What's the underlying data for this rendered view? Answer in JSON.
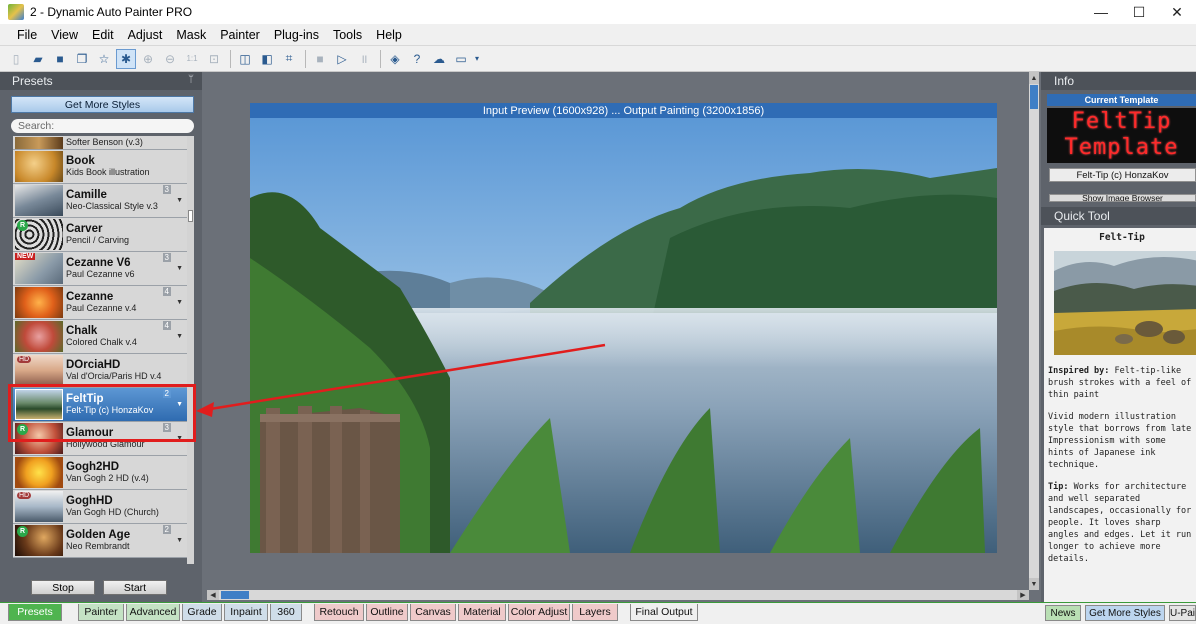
{
  "window": {
    "title": "2 - Dynamic Auto Painter PRO",
    "minimize": "—",
    "maximize": "☐",
    "close": "✕"
  },
  "menu": [
    "File",
    "View",
    "Edit",
    "Adjust",
    "Mask",
    "Painter",
    "Plug-ins",
    "Tools",
    "Help"
  ],
  "left_panel": {
    "header": "Presets",
    "pin_icon": "pin-icon",
    "get_more_label": "Get More Styles",
    "search_placeholder": "Search:",
    "presets": [
      {
        "name": "",
        "sub": "Softer Benson (v.3)"
      },
      {
        "name": "Book",
        "sub": "Kids Book illustration"
      },
      {
        "name": "Camille",
        "sub": "Neo-Classical Style v.3",
        "num": "3"
      },
      {
        "name": "Carver",
        "sub": "Pencil / Carving",
        "badge": "R"
      },
      {
        "name": "Cezanne V6",
        "sub": "Paul Cezanne v6",
        "num": "3",
        "badge": "NEW"
      },
      {
        "name": "Cezanne",
        "sub": "Paul Cezanne v.4",
        "num": "4"
      },
      {
        "name": "Chalk",
        "sub": "Colored Chalk v.4",
        "num": "4"
      },
      {
        "name": "DOrciaHD",
        "sub": "Val d'Orcia/Paris HD v.4",
        "badge": "HD"
      },
      {
        "name": "FeltTip",
        "sub": "Felt-Tip (c) HonzaKov",
        "num": "2",
        "selected": true
      },
      {
        "name": "Glamour",
        "sub": "Hollywood Glamour",
        "num": "3",
        "badge": "R"
      },
      {
        "name": "Gogh2HD",
        "sub": "Van Gogh 2 HD (v.4)"
      },
      {
        "name": "GoghHD",
        "sub": "Van Gogh HD (Church)",
        "badge": "HD"
      },
      {
        "name": "Golden Age",
        "sub": "Neo Rembrandt",
        "num": "2",
        "badge": "R"
      }
    ],
    "stop_label": "Stop",
    "start_label": "Start"
  },
  "canvas": {
    "caption": "Input Preview (1600x928) ... Output Painting (3200x1856)"
  },
  "info_panel": {
    "header": "Info",
    "current_template_label": "Current Template",
    "led_line1": "FeltTip",
    "led_line2": "Template",
    "template_author": "Felt-Tip (c) HonzaKov",
    "show_browser_label": "Show Image Browser"
  },
  "quick_tool": {
    "header": "Quick Tool",
    "title": "Felt-Tip",
    "inspired_label": "Inspired by:",
    "inspired_text": " Felt-tip-like brush strokes with a feel of thin paint",
    "description": "Vivid modern illustration style that borrows from late Impressionism with some hints of Japanese ink technique.",
    "tip_label": "Tip:",
    "tip_text": " Works for architecture and well separated landscapes, occasionally for people. It loves sharp angles and edges. Let it run longer to achieve more details."
  },
  "bottom_tabs": [
    "Presets",
    "Painter",
    "Advanced",
    "Grade",
    "Inpaint",
    "360",
    "Retouch",
    "Outline",
    "Canvas",
    "Material",
    "Color Adjust",
    "Layers",
    "Final Output"
  ],
  "right_tabs": [
    "News",
    "Get More Styles",
    "U-Pai"
  ],
  "colors": {
    "accent_blue": "#2f6cb5",
    "highlight_red": "#e11d1d",
    "panel_gray": "#5e636b",
    "led_red": "#ff2a2a"
  }
}
